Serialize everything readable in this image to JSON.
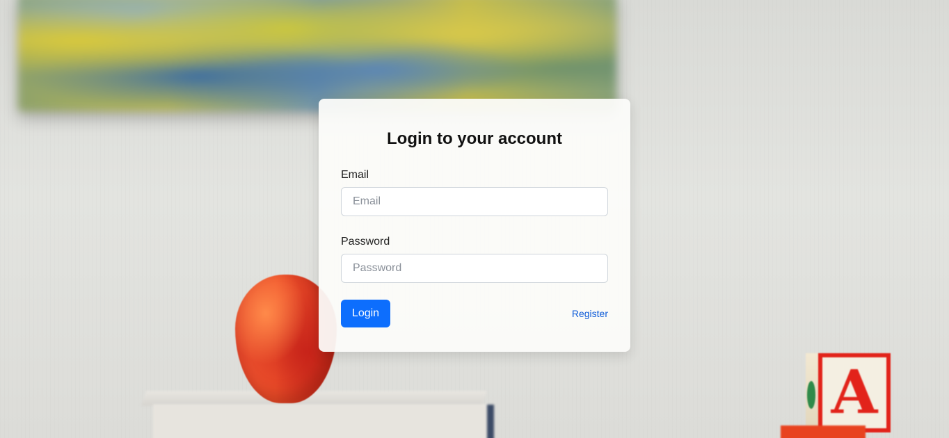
{
  "login": {
    "title": "Login to your account",
    "email_label": "Email",
    "email_placeholder": "Email",
    "email_value": "",
    "password_label": "Password",
    "password_placeholder": "Password",
    "password_value": "",
    "login_button": "Login",
    "register_link": "Register"
  },
  "background": {
    "block_letter": "A"
  },
  "colors": {
    "primary_button": "#0d6efd",
    "link": "#0d5bd8",
    "card_background": "#fcfcfa"
  }
}
